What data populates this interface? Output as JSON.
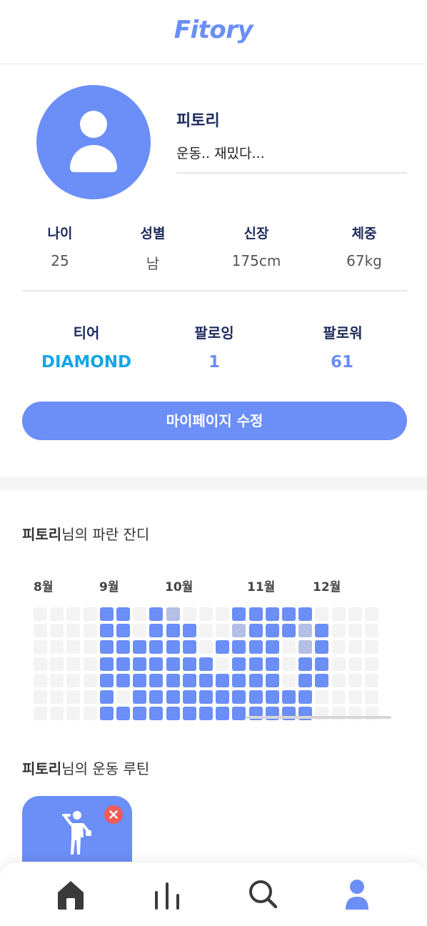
{
  "header": {
    "logo": "Fitory"
  },
  "profile": {
    "nickname": "피토리",
    "bio": "운동.. 재밌다..."
  },
  "stats": [
    {
      "label": "나이",
      "value": "25"
    },
    {
      "label": "성별",
      "value": "남"
    },
    {
      "label": "신장",
      "value": "175cm"
    },
    {
      "label": "체중",
      "value": "67kg"
    }
  ],
  "social": {
    "tier_label": "티어",
    "tier_value": "DIAMOND",
    "following_label": "팔로잉",
    "following_value": "1",
    "followers_label": "팔로워",
    "followers_value": "61"
  },
  "edit_button": "마이페이지 수정",
  "grass": {
    "title_name": "피토리",
    "title_suffix": "님의 파란 잔디",
    "months": [
      "8월",
      "9월",
      "10월",
      "11월",
      "12월"
    ],
    "colors": {
      "0": "#f3f3f3",
      "1": "#b4bfe6",
      "2": "#6b8ef7"
    },
    "rows": [
      "000042041000222220000",
      "000022022200122212000",
      "000022222202222012000",
      "000022222220222022000",
      "000022222222222022000",
      "000020222222222220000",
      "000022222222222220000"
    ]
  },
  "routine": {
    "title_name": "피토리",
    "title_suffix": "님의 운동 루틴"
  },
  "nav": [
    "home-icon",
    "chart-icon",
    "search-icon",
    "profile-icon"
  ],
  "accent_color": "#6b8ef7",
  "tier_color": "#14a6e6"
}
